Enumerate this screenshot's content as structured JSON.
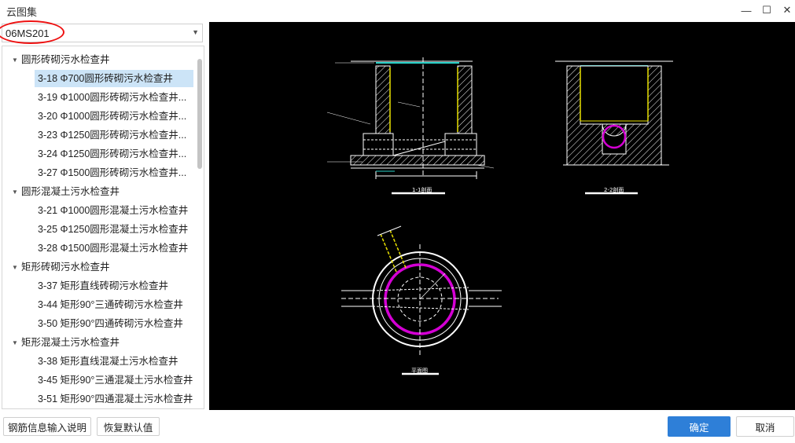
{
  "window": {
    "title": "云图集"
  },
  "window_controls": {
    "minimize": "—",
    "maximize": "☐",
    "close": "✕"
  },
  "atlas_select": {
    "value": "06MS201"
  },
  "tree": {
    "groups": [
      {
        "label": "圆形砖砌污水检查井",
        "items": [
          "3-18 Φ700圆形砖砌污水检查井",
          "3-19 Φ1000圆形砖砌污水检查井...",
          "3-20 Φ1000圆形砖砌污水检查井...",
          "3-23 Φ1250圆形砖砌污水检查井...",
          "3-24 Φ1250圆形砖砌污水检查井...",
          "3-27 Φ1500圆形砖砌污水检查井..."
        ]
      },
      {
        "label": "圆形混凝土污水检查井",
        "items": [
          "3-21 Φ1000圆形混凝土污水检查井",
          "3-25 Φ1250圆形混凝土污水检查井",
          "3-28 Φ1500圆形混凝土污水检查井"
        ]
      },
      {
        "label": "矩形砖砌污水检查井",
        "items": [
          "3-37 矩形直线砖砌污水检查井",
          "3-44 矩形90°三通砖砌污水检查井",
          "3-50 矩形90°四通砖砌污水检查井"
        ]
      },
      {
        "label": "矩形混凝土污水检查井",
        "items": [
          "3-38 矩形直线混凝土污水检查井",
          "3-45 矩形90°三通混凝土污水检查井",
          "3-51 矩形90°四通混凝土污水检查井"
        ]
      }
    ]
  },
  "drawing": {
    "section1_title": "1-1剖面",
    "section2_title": "2-2剖面",
    "plan_title": "平面图"
  },
  "buttons": {
    "rebar_info": "钢筋信息输入说明",
    "restore_default": "恢复默认值",
    "ok": "确定",
    "cancel": "取消"
  }
}
